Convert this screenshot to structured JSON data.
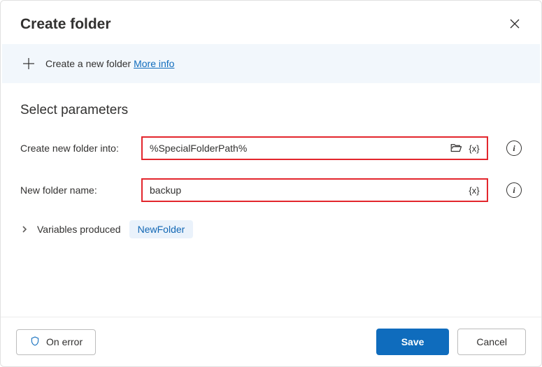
{
  "header": {
    "title": "Create folder"
  },
  "infobar": {
    "text": "Create a new folder",
    "link": "More info"
  },
  "section": {
    "title": "Select parameters"
  },
  "fields": {
    "into": {
      "label": "Create new folder into:",
      "value": "%SpecialFolderPath%"
    },
    "name": {
      "label": "New folder name:",
      "value": "backup"
    }
  },
  "variables": {
    "label": "Variables produced",
    "pill": "NewFolder"
  },
  "footer": {
    "onerror": "On error",
    "save": "Save",
    "cancel": "Cancel"
  }
}
